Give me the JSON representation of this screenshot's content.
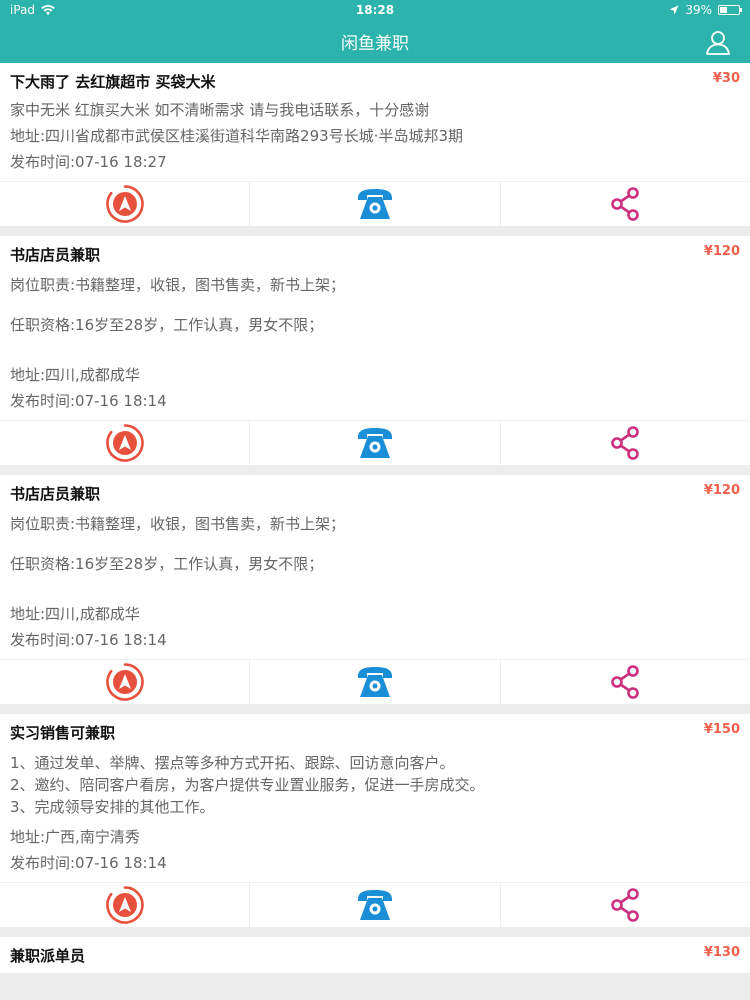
{
  "status": {
    "device": "iPad",
    "time": "18:28",
    "battery_text": "39%",
    "battery_level": 0.39
  },
  "nav": {
    "title": "闲鱼兼职"
  },
  "colors": {
    "accent": "#2cb3ac",
    "price": "#f0604c",
    "navigate": "#e8503e",
    "phone": "#1a8fd8",
    "share": "#cc2f7e"
  },
  "jobs": [
    {
      "title": "下大雨了 去红旗超市 买袋大米",
      "price": "¥30",
      "desc": "家中无米 红旗买大米 如不清晰需求 请与我电话联系，十分感谢",
      "address": "地址:四川省成都市武侯区桂溪街道科华南路293号长城·半岛城邦3期",
      "time": "发布时间:07-16 18:27"
    },
    {
      "title": "书店店员兼职",
      "price": "¥120",
      "duty": "岗位职责:书籍整理，收银，图书售卖，新书上架；",
      "requirement": "任职资格:16岁至28岁，工作认真，男女不限；",
      "address": "地址:四川,成都成华",
      "time": "发布时间:07-16 18:14"
    },
    {
      "title": "书店店员兼职",
      "price": "¥120",
      "duty": "岗位职责:书籍整理，收银，图书售卖，新书上架；",
      "requirement": "任职资格:16岁至28岁，工作认真，男女不限；",
      "address": "地址:四川,成都成华",
      "time": "发布时间:07-16 18:14"
    },
    {
      "title": "实习销售可兼职",
      "price": "¥150",
      "items": [
        "1、通过发单、举牌、摆点等多种方式开拓、跟踪、回访意向客户。",
        "2、邀约、陪同客户看房，为客户提供专业置业服务，促进一手房成交。",
        "3、完成领导安排的其他工作。"
      ],
      "address": "地址:广西,南宁清秀",
      "time": "发布时间:07-16 18:14"
    },
    {
      "title": "兼职派单员",
      "price": "¥130"
    }
  ]
}
